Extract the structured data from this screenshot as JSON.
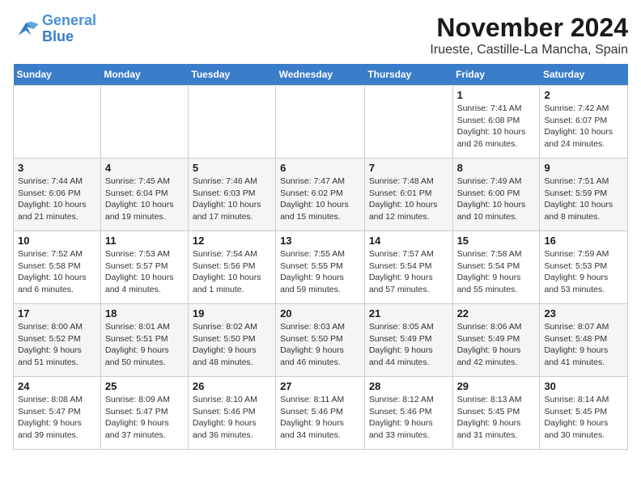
{
  "logo": {
    "line1": "General",
    "line2": "Blue"
  },
  "title": "November 2024",
  "location": "Irueste, Castille-La Mancha, Spain",
  "days_of_week": [
    "Sunday",
    "Monday",
    "Tuesday",
    "Wednesday",
    "Thursday",
    "Friday",
    "Saturday"
  ],
  "weeks": [
    [
      {
        "day": "",
        "info": ""
      },
      {
        "day": "",
        "info": ""
      },
      {
        "day": "",
        "info": ""
      },
      {
        "day": "",
        "info": ""
      },
      {
        "day": "",
        "info": ""
      },
      {
        "day": "1",
        "info": "Sunrise: 7:41 AM\nSunset: 6:08 PM\nDaylight: 10 hours and 26 minutes."
      },
      {
        "day": "2",
        "info": "Sunrise: 7:42 AM\nSunset: 6:07 PM\nDaylight: 10 hours and 24 minutes."
      }
    ],
    [
      {
        "day": "3",
        "info": "Sunrise: 7:44 AM\nSunset: 6:06 PM\nDaylight: 10 hours and 21 minutes."
      },
      {
        "day": "4",
        "info": "Sunrise: 7:45 AM\nSunset: 6:04 PM\nDaylight: 10 hours and 19 minutes."
      },
      {
        "day": "5",
        "info": "Sunrise: 7:46 AM\nSunset: 6:03 PM\nDaylight: 10 hours and 17 minutes."
      },
      {
        "day": "6",
        "info": "Sunrise: 7:47 AM\nSunset: 6:02 PM\nDaylight: 10 hours and 15 minutes."
      },
      {
        "day": "7",
        "info": "Sunrise: 7:48 AM\nSunset: 6:01 PM\nDaylight: 10 hours and 12 minutes."
      },
      {
        "day": "8",
        "info": "Sunrise: 7:49 AM\nSunset: 6:00 PM\nDaylight: 10 hours and 10 minutes."
      },
      {
        "day": "9",
        "info": "Sunrise: 7:51 AM\nSunset: 5:59 PM\nDaylight: 10 hours and 8 minutes."
      }
    ],
    [
      {
        "day": "10",
        "info": "Sunrise: 7:52 AM\nSunset: 5:58 PM\nDaylight: 10 hours and 6 minutes."
      },
      {
        "day": "11",
        "info": "Sunrise: 7:53 AM\nSunset: 5:57 PM\nDaylight: 10 hours and 4 minutes."
      },
      {
        "day": "12",
        "info": "Sunrise: 7:54 AM\nSunset: 5:56 PM\nDaylight: 10 hours and 1 minute."
      },
      {
        "day": "13",
        "info": "Sunrise: 7:55 AM\nSunset: 5:55 PM\nDaylight: 9 hours and 59 minutes."
      },
      {
        "day": "14",
        "info": "Sunrise: 7:57 AM\nSunset: 5:54 PM\nDaylight: 9 hours and 57 minutes."
      },
      {
        "day": "15",
        "info": "Sunrise: 7:58 AM\nSunset: 5:54 PM\nDaylight: 9 hours and 55 minutes."
      },
      {
        "day": "16",
        "info": "Sunrise: 7:59 AM\nSunset: 5:53 PM\nDaylight: 9 hours and 53 minutes."
      }
    ],
    [
      {
        "day": "17",
        "info": "Sunrise: 8:00 AM\nSunset: 5:52 PM\nDaylight: 9 hours and 51 minutes."
      },
      {
        "day": "18",
        "info": "Sunrise: 8:01 AM\nSunset: 5:51 PM\nDaylight: 9 hours and 50 minutes."
      },
      {
        "day": "19",
        "info": "Sunrise: 8:02 AM\nSunset: 5:50 PM\nDaylight: 9 hours and 48 minutes."
      },
      {
        "day": "20",
        "info": "Sunrise: 8:03 AM\nSunset: 5:50 PM\nDaylight: 9 hours and 46 minutes."
      },
      {
        "day": "21",
        "info": "Sunrise: 8:05 AM\nSunset: 5:49 PM\nDaylight: 9 hours and 44 minutes."
      },
      {
        "day": "22",
        "info": "Sunrise: 8:06 AM\nSunset: 5:49 PM\nDaylight: 9 hours and 42 minutes."
      },
      {
        "day": "23",
        "info": "Sunrise: 8:07 AM\nSunset: 5:48 PM\nDaylight: 9 hours and 41 minutes."
      }
    ],
    [
      {
        "day": "24",
        "info": "Sunrise: 8:08 AM\nSunset: 5:47 PM\nDaylight: 9 hours and 39 minutes."
      },
      {
        "day": "25",
        "info": "Sunrise: 8:09 AM\nSunset: 5:47 PM\nDaylight: 9 hours and 37 minutes."
      },
      {
        "day": "26",
        "info": "Sunrise: 8:10 AM\nSunset: 5:46 PM\nDaylight: 9 hours and 36 minutes."
      },
      {
        "day": "27",
        "info": "Sunrise: 8:11 AM\nSunset: 5:46 PM\nDaylight: 9 hours and 34 minutes."
      },
      {
        "day": "28",
        "info": "Sunrise: 8:12 AM\nSunset: 5:46 PM\nDaylight: 9 hours and 33 minutes."
      },
      {
        "day": "29",
        "info": "Sunrise: 8:13 AM\nSunset: 5:45 PM\nDaylight: 9 hours and 31 minutes."
      },
      {
        "day": "30",
        "info": "Sunrise: 8:14 AM\nSunset: 5:45 PM\nDaylight: 9 hours and 30 minutes."
      }
    ]
  ]
}
